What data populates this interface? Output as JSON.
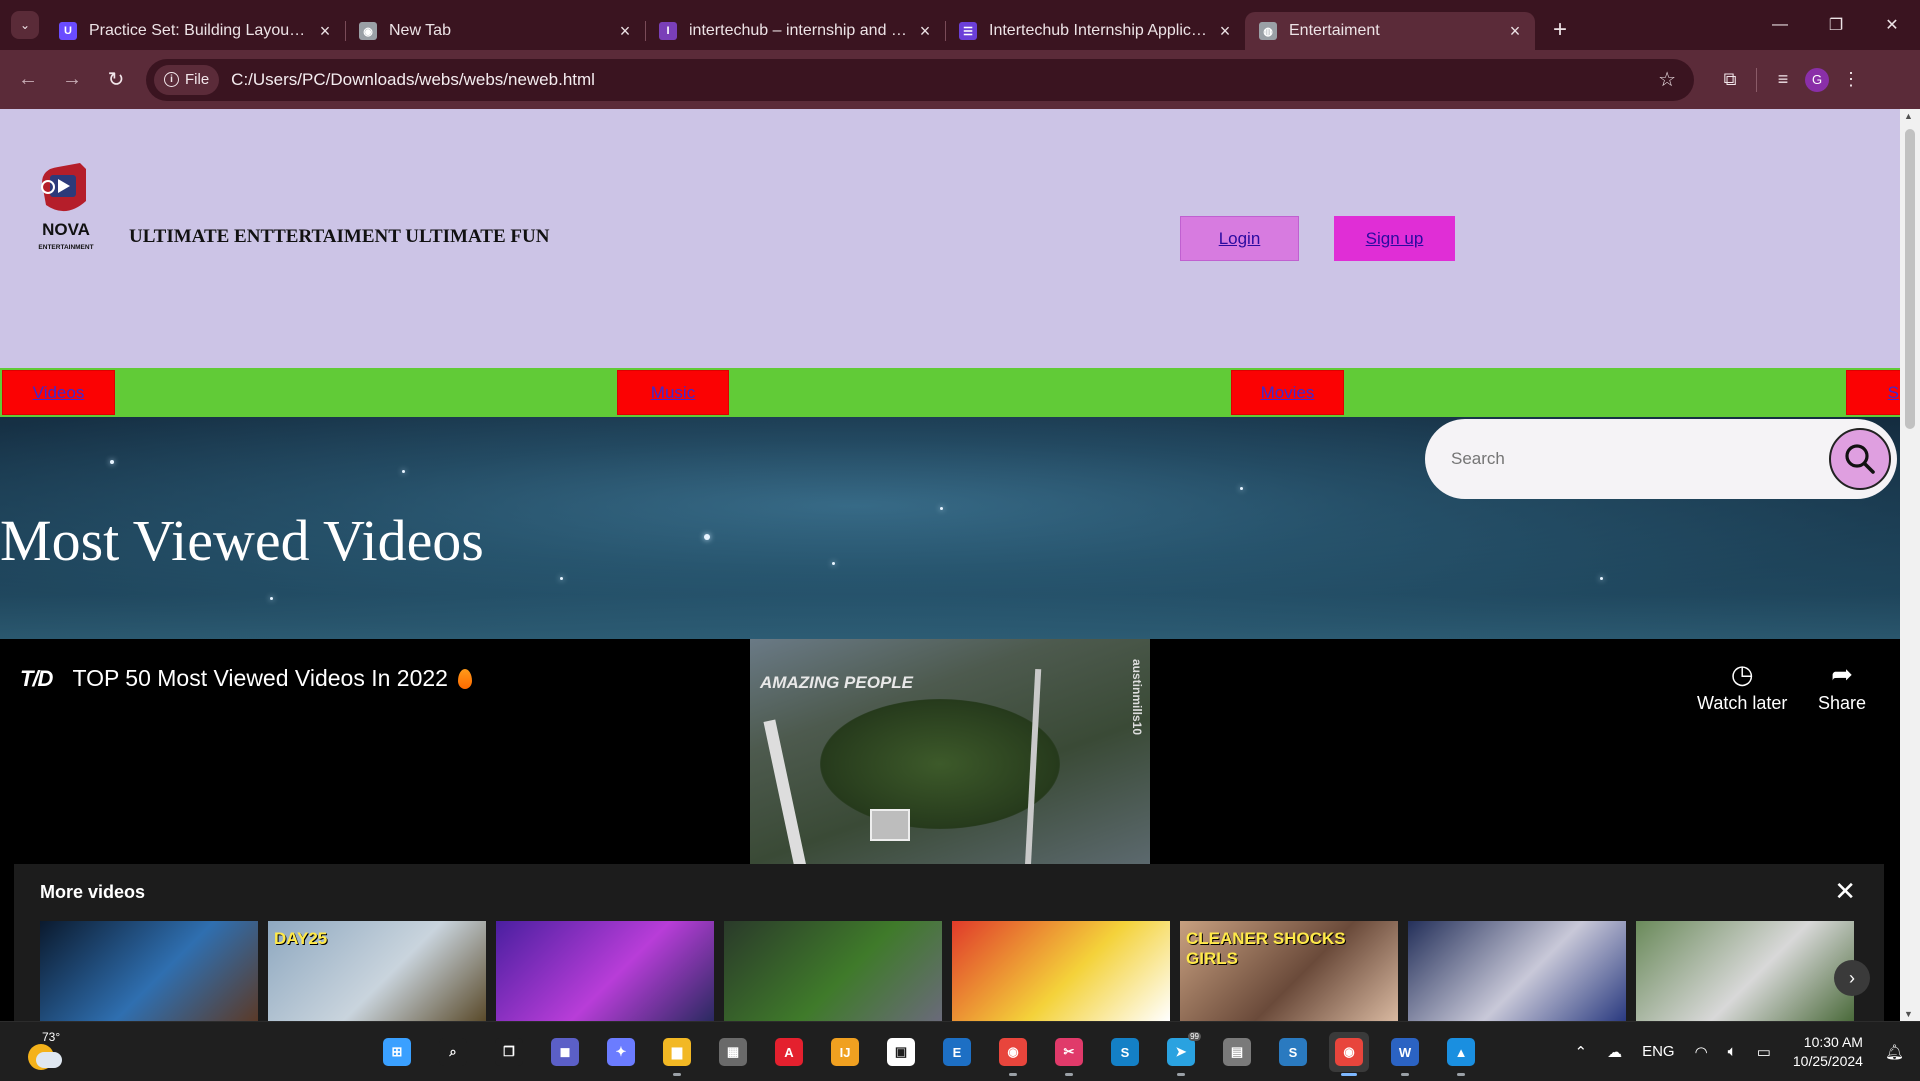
{
  "browser": {
    "tabs": [
      {
        "title": "Practice Set: Building Layouts -",
        "favicon_color": "#6a4cff",
        "favicon_glyph": "U"
      },
      {
        "title": "New Tab",
        "favicon_color": "#9aa0a6",
        "favicon_glyph": "◉"
      },
      {
        "title": "intertechub – internship and tec",
        "favicon_color": "#7a3fb8",
        "favicon_glyph": "I"
      },
      {
        "title": "Intertechub Internship Applicati",
        "favicon_color": "#6b3fd8",
        "favicon_glyph": "☰"
      },
      {
        "title": "Entertaiment",
        "favicon_color": "#9aa0a6",
        "favicon_glyph": "◍",
        "active": true
      }
    ],
    "address": {
      "chip_label": "File",
      "url": "C:/Users/PC/Downloads/webs/webs/neweb.html"
    },
    "profile_initial": "G",
    "accent": "#5b2b39"
  },
  "site": {
    "logo_text": "NOVA",
    "logo_subtext": "ENTERTAINMENT",
    "slogan": "ULTIMATE ENTTERTAIMENT ULTIMATE FUN",
    "login_label": "Login",
    "signup_label": "Sign up",
    "categories": [
      "Videos",
      "Music",
      "Movies",
      "S"
    ],
    "hero_title": "Most Viewed Videos",
    "search_placeholder": "Search"
  },
  "player": {
    "channel_logo": "T/D",
    "video_title": "TOP 50 Most Viewed Videos In 2022",
    "watch_later_label": "Watch later",
    "share_label": "Share",
    "frame_watermark": "AMAZING PEOPLE",
    "frame_handle": "austinmills10",
    "more_videos_label": "More videos",
    "thumbnails": [
      {
        "caption": "",
        "colors": [
          "#0b1a2e",
          "#2f6fb0",
          "#5b3a28"
        ]
      },
      {
        "caption": "DAY25",
        "colors": [
          "#8ea8c0",
          "#c9d4dd",
          "#5a4a2a"
        ]
      },
      {
        "caption": "",
        "colors": [
          "#4a1fa0",
          "#b83dd8",
          "#2a2a60"
        ]
      },
      {
        "caption": "",
        "colors": [
          "#2a3a2a",
          "#3f7a2a",
          "#6a6a7a"
        ]
      },
      {
        "caption": "",
        "colors": [
          "#e03a2a",
          "#f4d23a",
          "#ffffff"
        ]
      },
      {
        "caption": "CLEANER SHOCKS GIRLS",
        "colors": [
          "#c8a080",
          "#6a4a3a",
          "#d8b8a0"
        ]
      },
      {
        "caption": "",
        "colors": [
          "#24305a",
          "#c8c8d8",
          "#2a3a80"
        ]
      },
      {
        "caption": "",
        "colors": [
          "#6a8a5a",
          "#d8d8d8",
          "#4a6a3a"
        ]
      }
    ]
  },
  "taskbar": {
    "temperature": "73°",
    "language": "ENG",
    "time": "10:30 AM",
    "date": "10/25/2024",
    "telegram_badge": "99",
    "apps": [
      {
        "name": "start-icon",
        "color": "#3aa0ff",
        "glyph": "⊞"
      },
      {
        "name": "search-icon",
        "color": "#1f1f1f",
        "glyph": "⌕"
      },
      {
        "name": "task-view-icon",
        "color": "#1f1f1f",
        "glyph": "❐"
      },
      {
        "name": "meet-icon",
        "color": "#5b5fc7",
        "glyph": "◼"
      },
      {
        "name": "copilot-icon",
        "color": "#6b7cff",
        "glyph": "✦"
      },
      {
        "name": "file-explorer-icon",
        "color": "#f2b824",
        "glyph": "▆"
      },
      {
        "name": "calculator-icon",
        "color": "#6a6a6a",
        "glyph": "▦"
      },
      {
        "name": "autocad-icon",
        "color": "#e4202e",
        "glyph": "A"
      },
      {
        "name": "intellij-icon",
        "color": "#f0a020",
        "glyph": "IJ"
      },
      {
        "name": "store-icon",
        "color": "#ffffff",
        "glyph": "▣"
      },
      {
        "name": "outlook-icon",
        "color": "#1d6fc4",
        "glyph": "E"
      },
      {
        "name": "chrome-icon",
        "color": "#e8453c",
        "glyph": "◉"
      },
      {
        "name": "snipping-icon",
        "color": "#e03a6a",
        "glyph": "✂"
      },
      {
        "name": "sharepoint-icon",
        "color": "#1480c6",
        "glyph": "S"
      },
      {
        "name": "telegram-icon",
        "color": "#2aa2e0",
        "glyph": "➤"
      },
      {
        "name": "archive-icon",
        "color": "#7a7a7a",
        "glyph": "▤"
      },
      {
        "name": "sway-icon",
        "color": "#2a7ac0",
        "glyph": "S"
      },
      {
        "name": "chrome-profile-icon",
        "color": "#e8453c",
        "glyph": "◉",
        "active": true
      },
      {
        "name": "word-icon",
        "color": "#2b63c3",
        "glyph": "W"
      },
      {
        "name": "photos-icon",
        "color": "#1a8fe0",
        "glyph": "▲"
      }
    ]
  }
}
